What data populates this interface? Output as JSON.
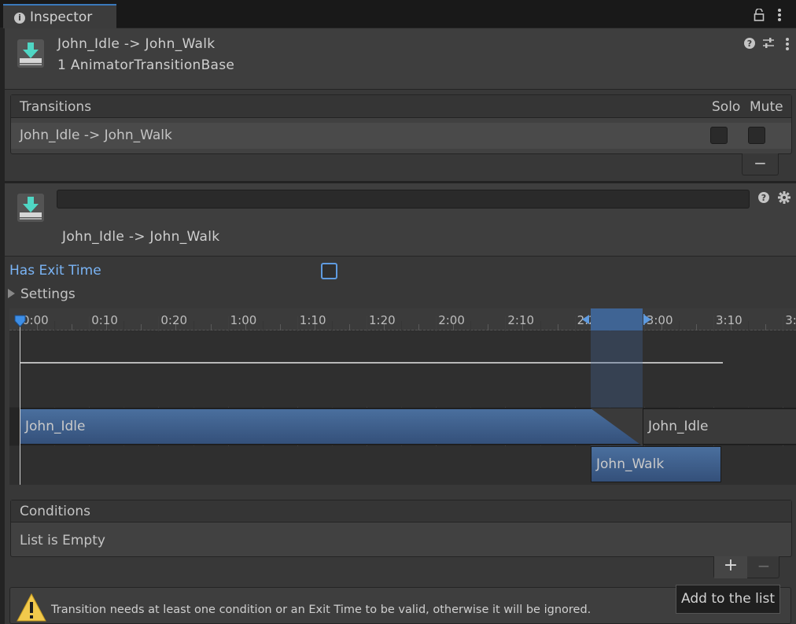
{
  "tab": {
    "label": "Inspector"
  },
  "header": {
    "title": "John_Idle -> John_Walk",
    "subtitle": "1 AnimatorTransitionBase"
  },
  "transitions_list": {
    "header": "Transitions",
    "col_solo": "Solo",
    "col_mute": "Mute",
    "rows": [
      {
        "label": "John_Idle -> John_Walk",
        "solo": false,
        "mute": false
      }
    ],
    "remove_label": "−"
  },
  "transition": {
    "name_value": "",
    "subtitle": "John_Idle -> John_Walk",
    "has_exit_time_label": "Has Exit Time",
    "has_exit_time": false,
    "settings_label": "Settings"
  },
  "timeline": {
    "ticks": [
      "0:00",
      "0:10",
      "0:20",
      "1:00",
      "1:10",
      "1:20",
      "2:00",
      "2:10",
      "2:20",
      "3:00",
      "3:10",
      "3:"
    ],
    "source_clip": "John_Idle",
    "source_clip_next": "John_Idle",
    "dest_clip": "John_Walk"
  },
  "conditions": {
    "header": "Conditions",
    "empty_text": "List is Empty",
    "add_label": "+",
    "remove_label": "−"
  },
  "tooltip": "Add to the list",
  "warning": "Transition needs at least one condition or an Exit Time to be valid, otherwise it will be ignored.",
  "colors": {
    "accent": "#3a79bb",
    "clip_blue": "#3e5f8a",
    "link_blue": "#7ab4f5"
  }
}
